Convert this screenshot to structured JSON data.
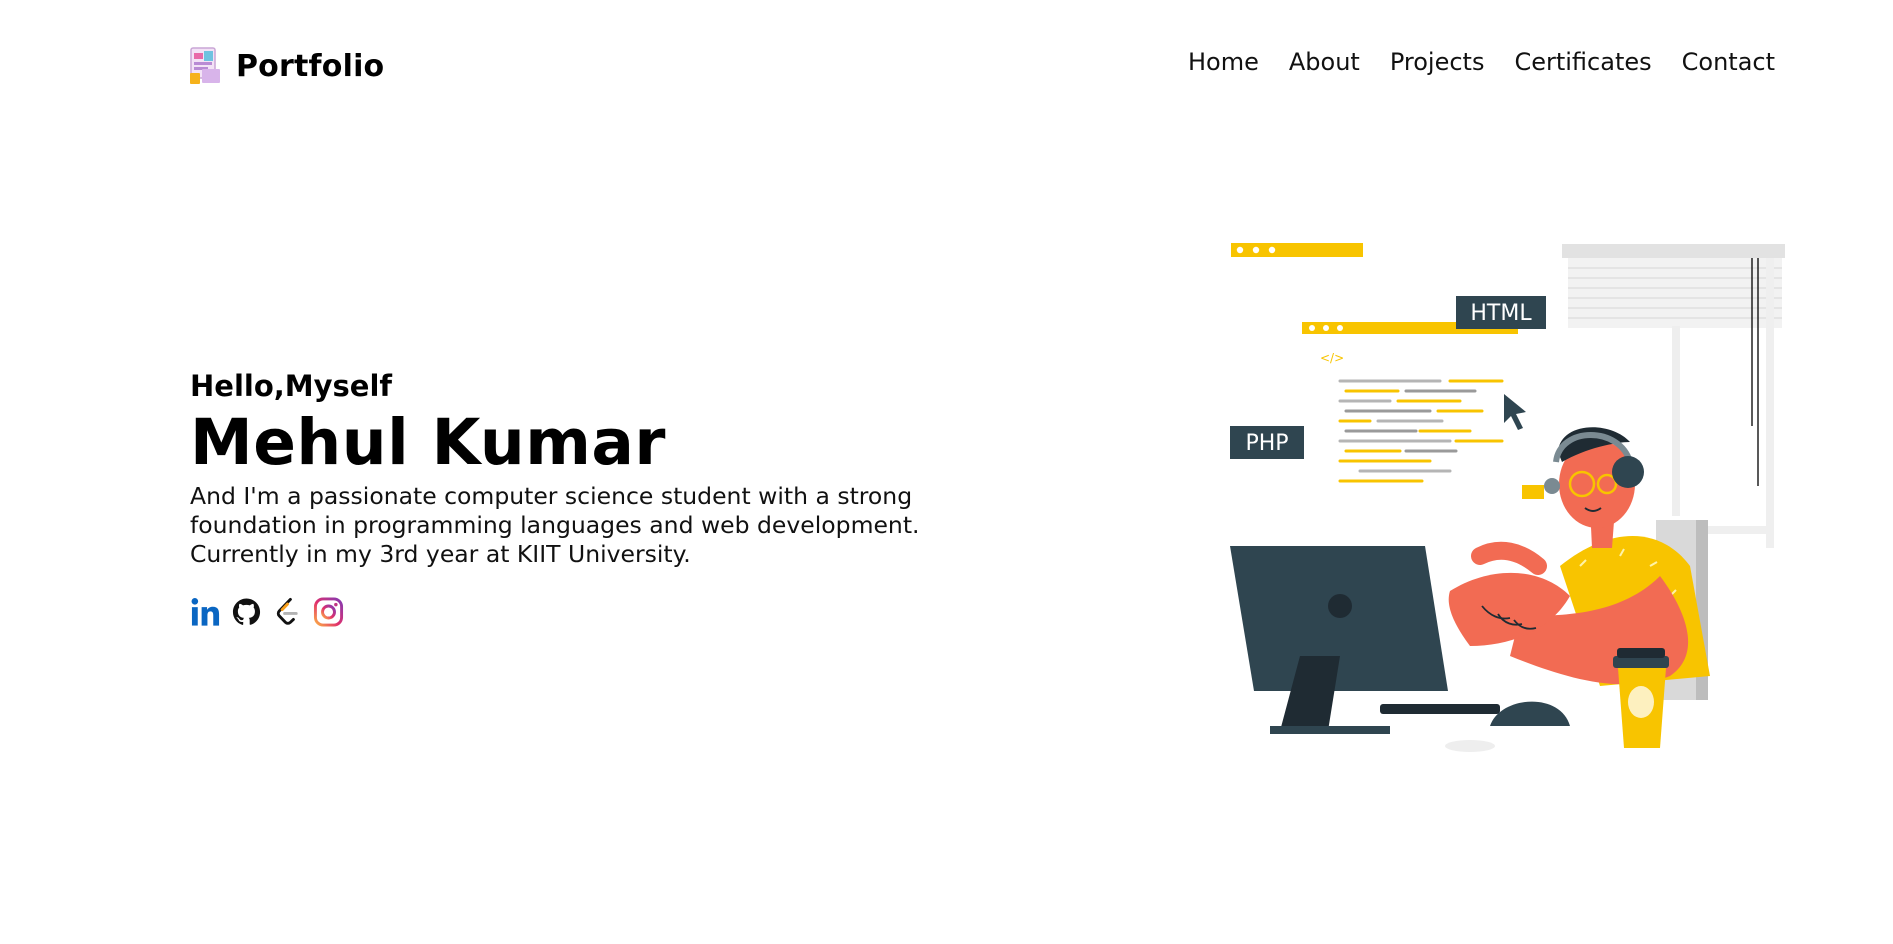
{
  "brand": {
    "name": "Portfolio",
    "logo_icon": "portfolio-logo-icon"
  },
  "nav": {
    "items": [
      "Home",
      "About",
      "Projects",
      "Certificates",
      "Contact"
    ]
  },
  "hero": {
    "greeting": "Hello,Myself",
    "name": "Mehul Kumar",
    "description_lines": [
      "And I'm a passionate computer science student with a strong",
      "foundation in programming languages and web development.",
      "Currently in my 3rd year at KIIT University."
    ]
  },
  "socials": [
    {
      "icon": "linkedin-icon",
      "color": "#0a66c2"
    },
    {
      "icon": "github-icon",
      "color": "#111111"
    },
    {
      "icon": "leetcode-icon",
      "color": "#f89f1b"
    },
    {
      "icon": "instagram-icon",
      "color": "#e1306c"
    }
  ],
  "illustration": {
    "tags": {
      "html": "HTML",
      "php": "PHP",
      "code": "</>"
    },
    "colors": {
      "yellow": "#f8c400",
      "dark": "#2f4550",
      "skin": "#f26b53"
    }
  }
}
